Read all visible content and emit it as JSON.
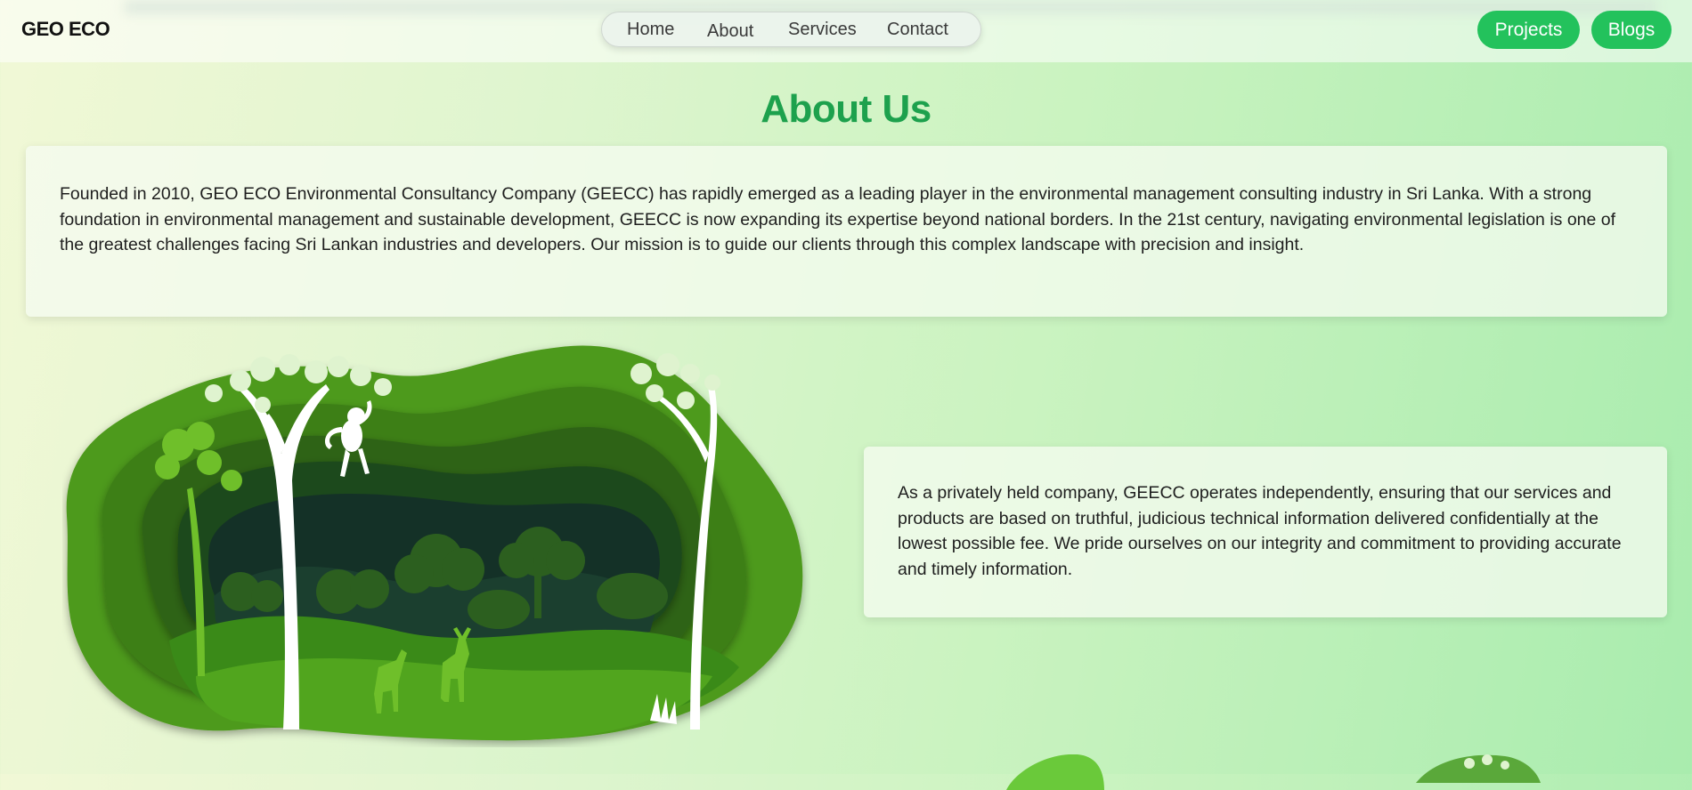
{
  "header": {
    "logo": "GEO ECO",
    "nav": [
      "Home",
      "About",
      "Services",
      "Contact"
    ],
    "actions": [
      "Projects",
      "Blogs"
    ]
  },
  "about": {
    "heading": "About Us",
    "paragraph1": "Founded in 2010, GEO ECO Environmental Consultancy Company (GEECC) has rapidly emerged as a leading player in the environmental management consulting industry in Sri Lanka. With a strong foundation in environmental management and sustainable development, GEECC is now expanding its expertise beyond national borders. In the 21st century, navigating environmental legislation is one of the greatest challenges facing Sri Lankan industries and developers. Our mission is to guide our clients through this complex landscape with precision and insight.",
    "paragraph2": "As a privately held company, GEECC operates independently, ensuring that our services and products are based on truthful, judicious technical information delivered confidentially at the lowest possible fee. We pride ourselves on our integrity and commitment to providing accurate and timely information."
  },
  "colors": {
    "accent": "#23c25c",
    "heading": "#1da14d"
  }
}
